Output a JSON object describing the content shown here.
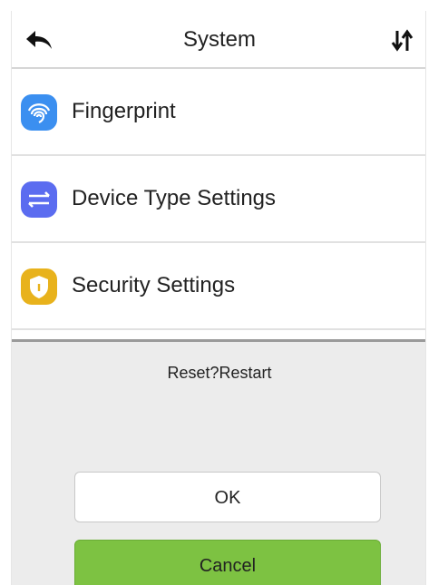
{
  "header": {
    "title": "System",
    "back_icon": "back-arrow-icon",
    "sort_icon": "sort-arrows-icon"
  },
  "menu": {
    "items": [
      {
        "label": "Fingerprint",
        "icon": "fingerprint-icon",
        "color": "#3b8ff0"
      },
      {
        "label": "Device Type Settings",
        "icon": "device-type-icon",
        "color": "#5b6cf0"
      },
      {
        "label": "Security Settings",
        "icon": "shield-icon",
        "color": "#e8b21c"
      }
    ]
  },
  "dialog": {
    "message": "Reset?Restart",
    "ok_label": "OK",
    "cancel_label": "Cancel",
    "cancel_color": "#7dc242"
  }
}
